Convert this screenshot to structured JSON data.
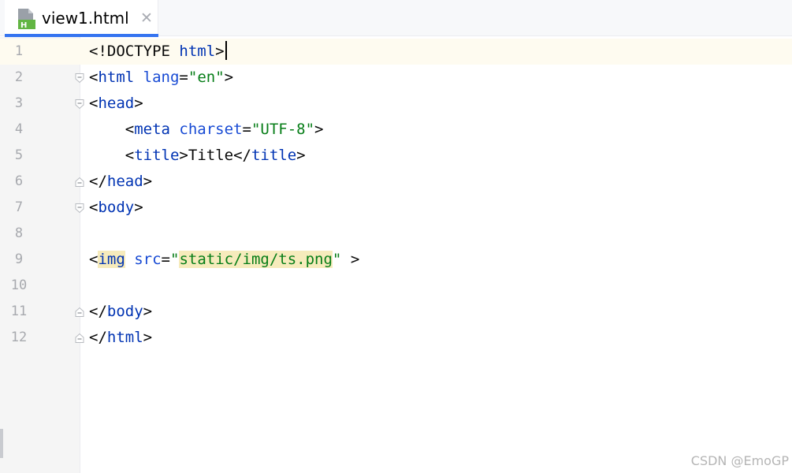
{
  "tab": {
    "filename": "view1.html",
    "icon": "html-file-icon",
    "icon_letter": "H",
    "close_glyph": "✕"
  },
  "editor": {
    "current_line": 1,
    "lines": [
      {
        "num": "1"
      },
      {
        "num": "2"
      },
      {
        "num": "3"
      },
      {
        "num": "4"
      },
      {
        "num": "5"
      },
      {
        "num": "6"
      },
      {
        "num": "7"
      },
      {
        "num": "8"
      },
      {
        "num": "9"
      },
      {
        "num": "10"
      },
      {
        "num": "11"
      },
      {
        "num": "12"
      }
    ],
    "code": {
      "l1": {
        "open": "<!DOCTYPE ",
        "kw": "html",
        "close": ">"
      },
      "l2": {
        "open": "<",
        "tag": "html",
        "attr": " lang",
        "eq": "=",
        "val": "\"en\"",
        "close": ">"
      },
      "l3": {
        "open": "<",
        "tag": "head",
        "close": ">"
      },
      "l4": {
        "indent": "    ",
        "open": "<",
        "tag": "meta",
        "attr": " charset",
        "eq": "=",
        "val": "\"UTF-8\"",
        "close": ">"
      },
      "l5": {
        "indent": "    ",
        "open": "<",
        "tag": "title",
        "close": ">",
        "text": "Title",
        "open2": "</",
        "tag2": "title",
        "close2": ">"
      },
      "l6": {
        "open": "</",
        "tag": "head",
        "close": ">"
      },
      "l7": {
        "open": "<",
        "tag": "body",
        "close": ">"
      },
      "l9": {
        "open": "<",
        "tag": "img",
        "attr": " src",
        "eq": "=",
        "q1": "\"",
        "val": "static/img/ts.png",
        "q2": "\"",
        "close": " >"
      },
      "l11": {
        "open": "</",
        "tag": "body",
        "close": ">"
      },
      "l12": {
        "open": "</",
        "tag": "html",
        "close": ">"
      }
    }
  },
  "colors": {
    "tag": "#0033b3",
    "attribute": "#174ad4",
    "string": "#067d17",
    "current_line_bg": "#fefbf0",
    "match_highlight": "#f6ebbc",
    "tab_accent": "#3574f0"
  },
  "watermark": "CSDN @EmoGP"
}
